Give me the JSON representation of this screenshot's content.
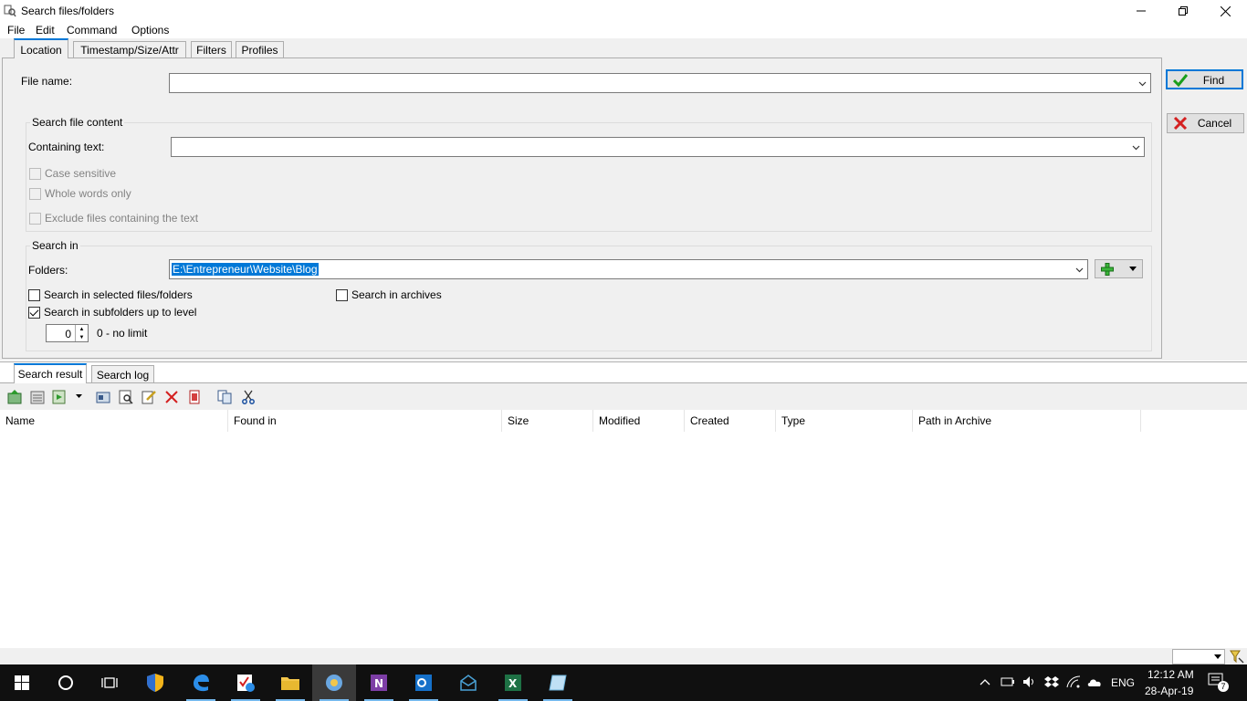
{
  "window": {
    "title": "Search files/folders",
    "controls": [
      "minimize",
      "restore",
      "close"
    ]
  },
  "menu": [
    "File",
    "Edit",
    "Command",
    "Options"
  ],
  "tabs": [
    "Location",
    "Timestamp/Size/Attr",
    "Filters",
    "Profiles"
  ],
  "location": {
    "file_name_label": "File name:",
    "file_name_value": "",
    "content_group_title": "Search file content",
    "containing_text_label": "Containing text:",
    "containing_text_value": "",
    "case_sensitive": "Case sensitive",
    "whole_words": "Whole words only",
    "exclude_files": "Exclude files containing the text",
    "search_in_title": "Search in",
    "folders_label": "Folders:",
    "folders_value": "E:\\Entrepreneur\\Website\\Blog",
    "search_selected": "Search in selected files/folders",
    "search_archives": "Search in archives",
    "search_subfolders": "Search in subfolders up to level",
    "level_value": "0",
    "level_hint": "0 - no limit"
  },
  "buttons": {
    "find": "Find",
    "cancel": "Cancel"
  },
  "result_tabs": [
    "Search result",
    "Search log"
  ],
  "columns": [
    "Name",
    "Found in",
    "Size",
    "Modified",
    "Created",
    "Type",
    "Path in Archive"
  ],
  "taskbar": {
    "lang": "ENG",
    "time": "12:12 AM",
    "date": "28-Apr-19",
    "notifications": "7"
  },
  "colors": {
    "accent": "#0078d7",
    "find_check": "#1a9e1a",
    "cancel_x": "#d42020"
  }
}
